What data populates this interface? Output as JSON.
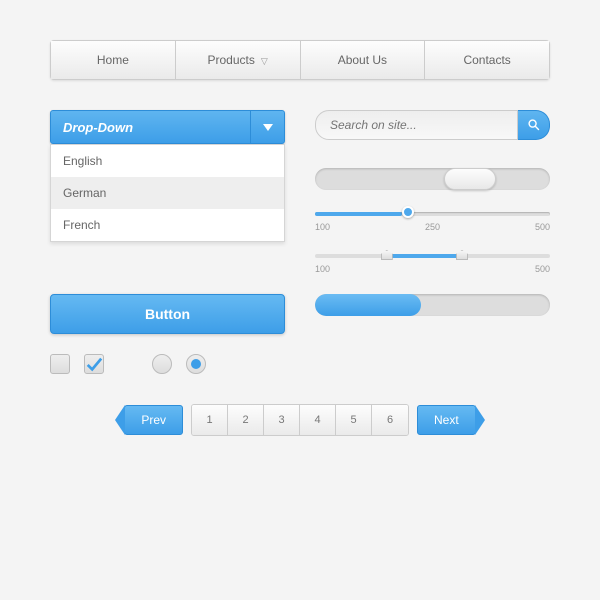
{
  "nav": {
    "items": [
      "Home",
      "Products",
      "About Us",
      "Contacts"
    ]
  },
  "dropdown": {
    "label": "Drop-Down",
    "options": [
      "English",
      "German",
      "French"
    ],
    "selected": 1
  },
  "search": {
    "placeholder": "Search on site..."
  },
  "button": {
    "label": "Button"
  },
  "slider": {
    "min": "100",
    "mid": "250",
    "max": "500",
    "value": 37
  },
  "range": {
    "min": "100",
    "max": "500",
    "from": 30,
    "to": 62
  },
  "progress": {
    "value": 45
  },
  "pager": {
    "prev": "Prev",
    "next": "Next",
    "pages": [
      "1",
      "2",
      "3",
      "4",
      "5",
      "6"
    ]
  }
}
